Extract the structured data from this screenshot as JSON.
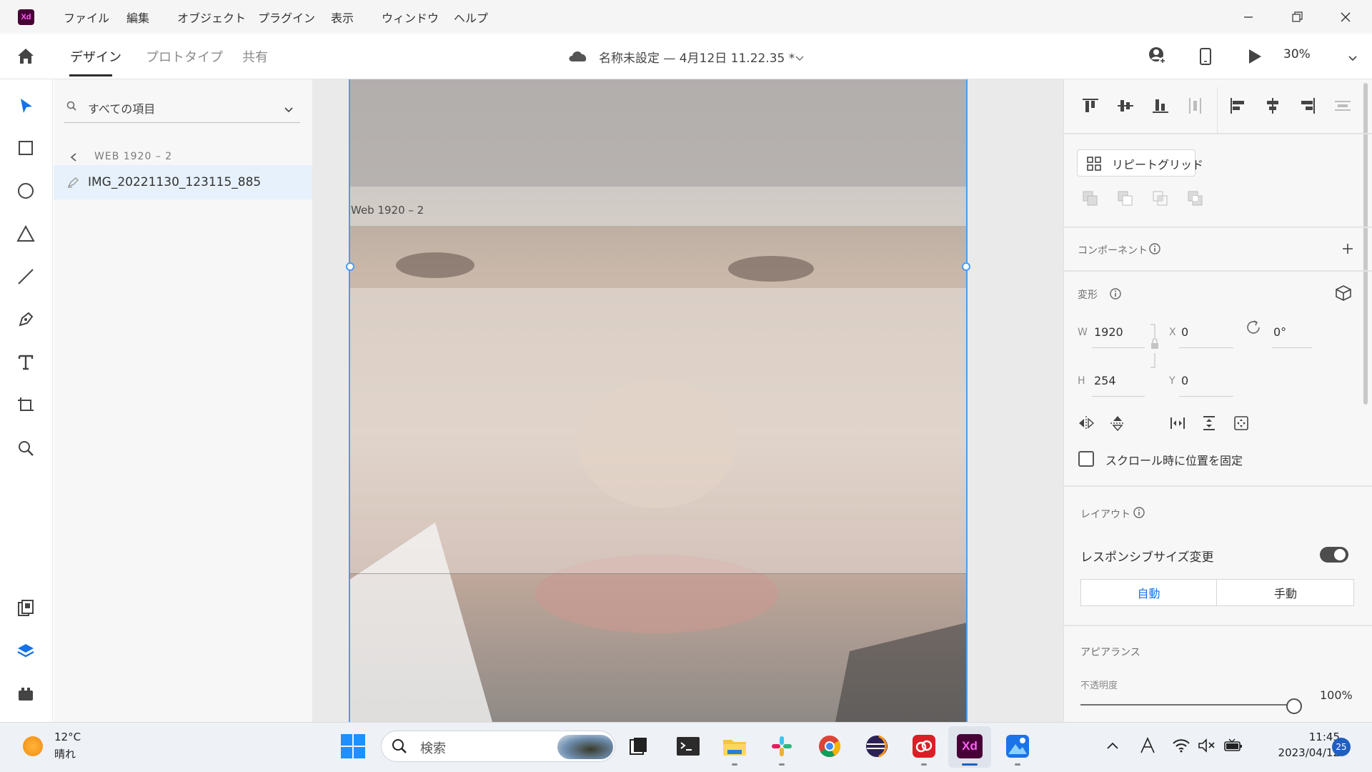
{
  "app": {
    "logo_text": "Xd",
    "menu": [
      "ファイル",
      "編集",
      "オブジェクト",
      "プラグイン",
      "表示",
      "ウィンドウ",
      "ヘルプ"
    ]
  },
  "appbar": {
    "tabs": [
      "デザイン",
      "プロトタイプ",
      "共有"
    ],
    "document_title": "名称未設定 — 4月12日 11.22.35 *",
    "zoom": "30%"
  },
  "layers": {
    "search_placeholder": "すべての項目",
    "breadcrumb": "WEB 1920 – 2",
    "items": [
      {
        "label": "IMG_20221130_123115_885"
      }
    ]
  },
  "canvas": {
    "artboard_label": "Web 1920 – 2"
  },
  "inspector": {
    "repeat_grid_label": "リピートグリッド",
    "component_title": "コンポーネント",
    "transform_title": "変形",
    "w_label": "W",
    "w_value": "1920",
    "h_label": "H",
    "h_value": "254",
    "x_label": "X",
    "x_value": "0",
    "y_label": "Y",
    "y_value": "0",
    "rotation_value": "0°",
    "fix_position_label": "スクロール時に位置を固定",
    "layout_title": "レイアウト",
    "responsive_label": "レスポンシブサイズ変更",
    "responsive_on": true,
    "segment_auto": "自動",
    "segment_manual": "手動",
    "appearance_title": "アピアランス",
    "opacity_label": "不透明度",
    "opacity_value": "100%"
  },
  "taskbar": {
    "weather_temp": "12°C",
    "weather_desc": "晴れ",
    "search_placeholder": "検索",
    "xd_label": "Xd",
    "clock_time": "11:45",
    "clock_date": "2023/04/12",
    "notification_count": "25"
  },
  "colors": {
    "accent": "#1473e6",
    "selection": "#4b9cf0",
    "xd_brand": "#470137",
    "xd_brand_text": "#ff61f6"
  }
}
